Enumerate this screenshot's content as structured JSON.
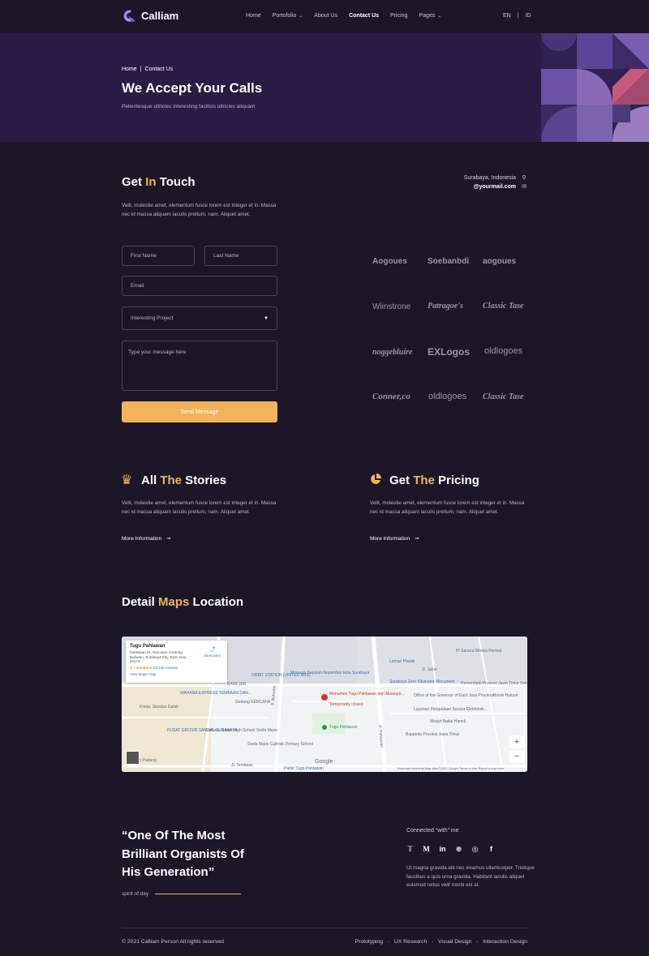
{
  "nav": {
    "logo_text": "Calliam",
    "items": [
      {
        "label": "Home",
        "dropdown": false,
        "active": false
      },
      {
        "label": "Portofolio",
        "dropdown": true,
        "active": false
      },
      {
        "label": "About Us",
        "dropdown": false,
        "active": false
      },
      {
        "label": "Contact Us",
        "dropdown": false,
        "active": true
      },
      {
        "label": "Pricing",
        "dropdown": false,
        "active": false
      },
      {
        "label": "Pages",
        "dropdown": true,
        "active": false
      }
    ],
    "lang": {
      "en": "EN",
      "sep": "|",
      "id": "ID"
    }
  },
  "hero": {
    "breadcrumb": {
      "home": "Home",
      "sep": "|",
      "current": "Contact Us"
    },
    "title": "We Accept Your Calls",
    "subtitle": "Pellentesque ultricies interesting facilisis ultricies aliquam"
  },
  "touch": {
    "title_pre": "Get ",
    "title_acc": "In",
    "title_post": " Touch",
    "text": "Velit, molestie amet, elementum fusce lorem est integer et in. Massa nec id massa aliquam iaculis pretium, nam. Aliquet amet.",
    "location": "Surabaya, Indonesia",
    "email": "@yourmail.com",
    "location_icon": "map-pin-icon",
    "email_icon": "envelope-icon"
  },
  "form": {
    "first_name_ph": "First Name",
    "last_name_ph": "Last Name",
    "email_ph": "Email",
    "select_value": "Interesting Project",
    "message_ph": "Type your message here",
    "send": "Send Message"
  },
  "brands": [
    "Aogoues",
    "Soebanbdi",
    "aogoues",
    "Wiinstrone",
    "Patragoe's",
    "Classic Tase",
    "noggebluire",
    "EXLogos",
    "oldlogoes",
    "Conner,co",
    "oldlogoes",
    "Classic Tase"
  ],
  "features": [
    {
      "icon": "crown-icon",
      "title_pre": "All ",
      "title_acc": "The",
      "title_post": " Stories",
      "text": "Velit, molestie amet, elementum fusce lorem est integer et in. Massa nec id massa aliquam iaculis pretium, nam. Aliquet amet.",
      "link": "More Information"
    },
    {
      "icon": "pie-chart-icon",
      "title_pre": "Get ",
      "title_acc": "The",
      "title_post": " Pricing",
      "text": "Velit, molestie amet, elementum fusce lorem est integer et in. Massa nec id massa aliquam iaculis pretium, nam. Aliquet amet.",
      "link": "More Information"
    }
  ],
  "maps": {
    "title_pre": "Detail ",
    "title_acc": "Maps",
    "title_post": " Location",
    "card_title": "Tugu Pahlawan",
    "card_addr": "Pahlawan St, Alun-alun Contong, Bubutan, Surabaya City, East Java 60174",
    "card_rating": "4.7 ★★★★★",
    "card_reviews": "20,138 reviews",
    "card_larger": "View larger map",
    "card_directions": "Directions",
    "labels": {
      "monument": "Monumen Tugu Pahlawan dan Museum...",
      "temp": "Temporarily closed",
      "tugu": "Tugu Pahlawan",
      "museum": "Museum Sepuluh Nopember kota Surabaya",
      "wahana": "WAHANA EXPRESS TEMBAAN DAN...",
      "komp": "Komp. Siwalan Galah",
      "pusat": "PUSAT GROSIR SANDAL SURABAYA",
      "gedung": "Gedung KENCANA",
      "catholic": "Catholic Junior High School Stella Maris",
      "stella": "Stella Maris Catholic Primary School",
      "parkir": "Parkir Tugu Pahlawan",
      "rumah": "Rumah Padang",
      "office": "Office of the Governor of East Java Province",
      "bapenda": "Bappeda Provinsi Jawa Timur",
      "masjid": "Masjid Baitul Hamdi",
      "bisnis": "Bisnis Hukum",
      "sama": "Pt Sarana Wisma Permai",
      "orbit": "ORBIT STATION (UNITED BRS)",
      "bank": "BANK BRI",
      "surabaya_zero": "Surabaya Zero Kilometer Monument",
      "layanan": "Layanan Pengadaan Secara Elektronik...",
      "pemerintah": "Pemerintah Provinsi Jawa Timur Sekretariat Daerah",
      "lemari": "Lemari Plastik",
      "jl_pahlawan": "Jl. Pahlawan",
      "jl_bubutan": "Jl. Bubutan",
      "jl_tembaan": "Jl. Tembaan",
      "jl_jahar": "Jl. Jahar",
      "google": "Google",
      "attrib": "Keyboard shortcuts  Map data ©2021 Google  Terms of Use  Report a map error"
    }
  },
  "quote": {
    "text": "“One Of The Most Brilliant Organists Of His Generation”",
    "author": "spirit of day"
  },
  "social": {
    "title": "Connected “with” me",
    "icons": [
      {
        "name": "twitter-icon",
        "glyph": "𝕋"
      },
      {
        "name": "medium-icon",
        "glyph": "M"
      },
      {
        "name": "linkedin-icon",
        "glyph": "in"
      },
      {
        "name": "dribbble-icon",
        "glyph": "⊛"
      },
      {
        "name": "instagram-icon",
        "glyph": "◎"
      },
      {
        "name": "facebook-icon",
        "glyph": "f"
      }
    ],
    "text": "Ut magna gravida elit nec vivamus ullamcorper. Tristique faucibus a quis urna gravida. Habitant iaculis aliquet euismod netus velit morbi est at."
  },
  "footer": {
    "copyright": "© 2021 Calliam Person All rights reserved",
    "links": [
      "Prototyping",
      "UX Research",
      "Visual Design",
      "Interaction Design"
    ]
  },
  "colors": {
    "background": "#1c1727",
    "hero": "#2a1c45",
    "accent": "#f2b35c"
  }
}
